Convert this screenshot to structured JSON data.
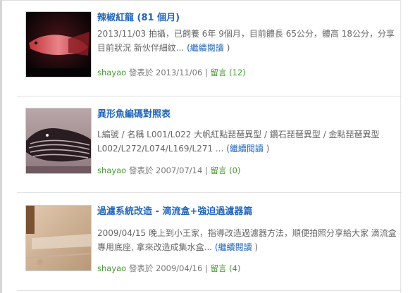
{
  "posts": [
    {
      "title": "辣椒紅龍",
      "count": "(81 個月)",
      "excerpt": "2013/11/03 拍攝，已飼養 6年 9個月，目前體長 65公分，體高 18公分，分享目前狀況 新伙伴細紋...",
      "read_more": "(繼續閱讀",
      "read_more_close": " )",
      "author": "shayao",
      "posted_label": " 發表於 ",
      "date": "2013/11/06",
      "divider": " | ",
      "comments_label": "留言",
      "comments_count": " (12)"
    },
    {
      "title": "異形魚編碼對照表",
      "count": "",
      "excerpt": "L編號 / 名稱 L001/L022 大帆紅點琵琶異型 / 鑽石琵琶異型 / 金點琵琶異型 L002/L272/L074/L169/L271 ...",
      "read_more": "(繼續閱讀",
      "read_more_close": " )",
      "author": "shayao",
      "posted_label": " 發表於 ",
      "date": "2007/07/14",
      "divider": " | ",
      "comments_label": "留言",
      "comments_count": " (0)"
    },
    {
      "title": "過濾系統改造 - 滴流盒+強迫過濾器篇",
      "count": "",
      "excerpt": "2009/04/15 晚上到小王家，指導改造過濾器方法，順便拍照分享給大家 滴流盒專用底座, 拿來改造成集水盒...",
      "read_more": "(繼續閱讀",
      "read_more_close": " )",
      "author": "shayao",
      "posted_label": " 發表於 ",
      "date": "2009/04/16",
      "divider": " | ",
      "comments_label": "留言",
      "comments_count": " (4)"
    }
  ],
  "colors": {
    "link": "#2266bb",
    "author": "#44992e",
    "text": "#666666"
  },
  "icons": [
    "arowana-thumbnail",
    "pleco-thumbnail",
    "filter-box-thumbnail"
  ]
}
